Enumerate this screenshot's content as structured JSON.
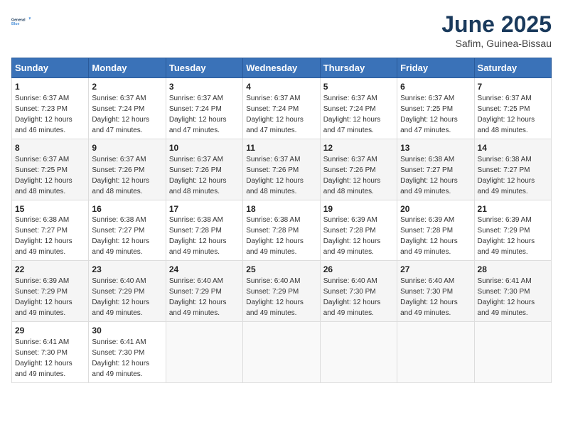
{
  "logo": {
    "line1": "General",
    "line2": "Blue"
  },
  "title": "June 2025",
  "subtitle": "Safim, Guinea-Bissau",
  "days_of_week": [
    "Sunday",
    "Monday",
    "Tuesday",
    "Wednesday",
    "Thursday",
    "Friday",
    "Saturday"
  ],
  "weeks": [
    [
      {
        "day": "1",
        "sunrise": "6:37 AM",
        "sunset": "7:23 PM",
        "daylight": "12 hours and 46 minutes."
      },
      {
        "day": "2",
        "sunrise": "6:37 AM",
        "sunset": "7:24 PM",
        "daylight": "12 hours and 47 minutes."
      },
      {
        "day": "3",
        "sunrise": "6:37 AM",
        "sunset": "7:24 PM",
        "daylight": "12 hours and 47 minutes."
      },
      {
        "day": "4",
        "sunrise": "6:37 AM",
        "sunset": "7:24 PM",
        "daylight": "12 hours and 47 minutes."
      },
      {
        "day": "5",
        "sunrise": "6:37 AM",
        "sunset": "7:24 PM",
        "daylight": "12 hours and 47 minutes."
      },
      {
        "day": "6",
        "sunrise": "6:37 AM",
        "sunset": "7:25 PM",
        "daylight": "12 hours and 47 minutes."
      },
      {
        "day": "7",
        "sunrise": "6:37 AM",
        "sunset": "7:25 PM",
        "daylight": "12 hours and 48 minutes."
      }
    ],
    [
      {
        "day": "8",
        "sunrise": "6:37 AM",
        "sunset": "7:25 PM",
        "daylight": "12 hours and 48 minutes."
      },
      {
        "day": "9",
        "sunrise": "6:37 AM",
        "sunset": "7:26 PM",
        "daylight": "12 hours and 48 minutes."
      },
      {
        "day": "10",
        "sunrise": "6:37 AM",
        "sunset": "7:26 PM",
        "daylight": "12 hours and 48 minutes."
      },
      {
        "day": "11",
        "sunrise": "6:37 AM",
        "sunset": "7:26 PM",
        "daylight": "12 hours and 48 minutes."
      },
      {
        "day": "12",
        "sunrise": "6:37 AM",
        "sunset": "7:26 PM",
        "daylight": "12 hours and 48 minutes."
      },
      {
        "day": "13",
        "sunrise": "6:38 AM",
        "sunset": "7:27 PM",
        "daylight": "12 hours and 49 minutes."
      },
      {
        "day": "14",
        "sunrise": "6:38 AM",
        "sunset": "7:27 PM",
        "daylight": "12 hours and 49 minutes."
      }
    ],
    [
      {
        "day": "15",
        "sunrise": "6:38 AM",
        "sunset": "7:27 PM",
        "daylight": "12 hours and 49 minutes."
      },
      {
        "day": "16",
        "sunrise": "6:38 AM",
        "sunset": "7:27 PM",
        "daylight": "12 hours and 49 minutes."
      },
      {
        "day": "17",
        "sunrise": "6:38 AM",
        "sunset": "7:28 PM",
        "daylight": "12 hours and 49 minutes."
      },
      {
        "day": "18",
        "sunrise": "6:38 AM",
        "sunset": "7:28 PM",
        "daylight": "12 hours and 49 minutes."
      },
      {
        "day": "19",
        "sunrise": "6:39 AM",
        "sunset": "7:28 PM",
        "daylight": "12 hours and 49 minutes."
      },
      {
        "day": "20",
        "sunrise": "6:39 AM",
        "sunset": "7:28 PM",
        "daylight": "12 hours and 49 minutes."
      },
      {
        "day": "21",
        "sunrise": "6:39 AM",
        "sunset": "7:29 PM",
        "daylight": "12 hours and 49 minutes."
      }
    ],
    [
      {
        "day": "22",
        "sunrise": "6:39 AM",
        "sunset": "7:29 PM",
        "daylight": "12 hours and 49 minutes."
      },
      {
        "day": "23",
        "sunrise": "6:40 AM",
        "sunset": "7:29 PM",
        "daylight": "12 hours and 49 minutes."
      },
      {
        "day": "24",
        "sunrise": "6:40 AM",
        "sunset": "7:29 PM",
        "daylight": "12 hours and 49 minutes."
      },
      {
        "day": "25",
        "sunrise": "6:40 AM",
        "sunset": "7:29 PM",
        "daylight": "12 hours and 49 minutes."
      },
      {
        "day": "26",
        "sunrise": "6:40 AM",
        "sunset": "7:30 PM",
        "daylight": "12 hours and 49 minutes."
      },
      {
        "day": "27",
        "sunrise": "6:40 AM",
        "sunset": "7:30 PM",
        "daylight": "12 hours and 49 minutes."
      },
      {
        "day": "28",
        "sunrise": "6:41 AM",
        "sunset": "7:30 PM",
        "daylight": "12 hours and 49 minutes."
      }
    ],
    [
      {
        "day": "29",
        "sunrise": "6:41 AM",
        "sunset": "7:30 PM",
        "daylight": "12 hours and 49 minutes."
      },
      {
        "day": "30",
        "sunrise": "6:41 AM",
        "sunset": "7:30 PM",
        "daylight": "12 hours and 49 minutes."
      },
      null,
      null,
      null,
      null,
      null
    ]
  ]
}
